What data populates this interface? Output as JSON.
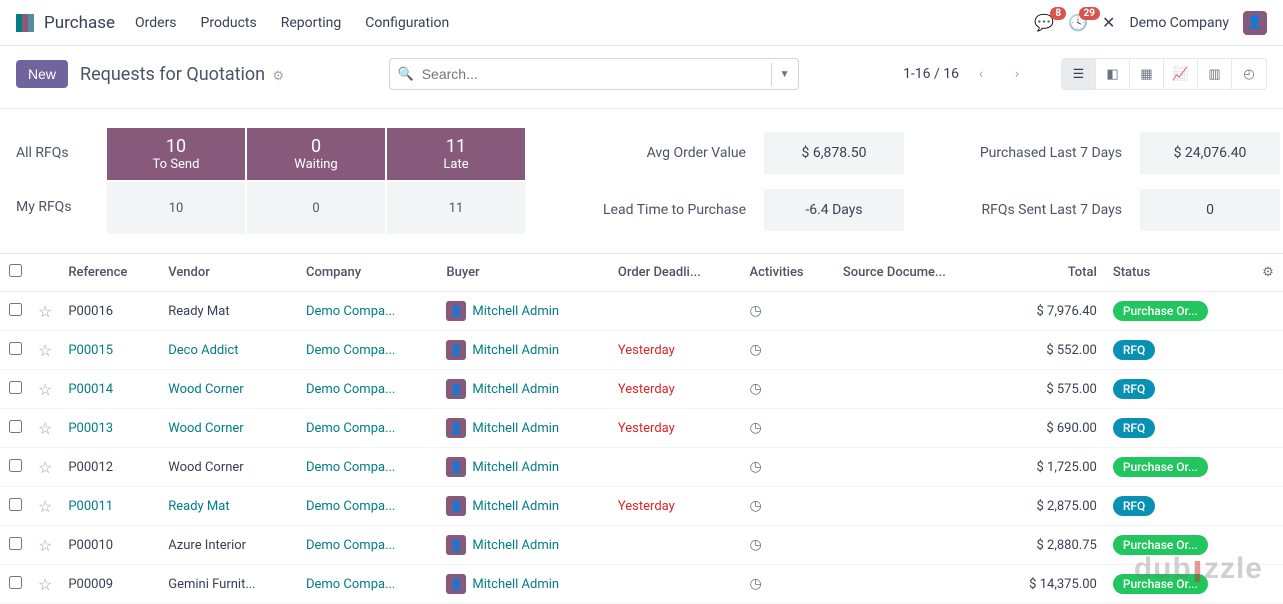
{
  "nav": {
    "app_name": "Purchase",
    "links": [
      "Orders",
      "Products",
      "Reporting",
      "Configuration"
    ],
    "msg_badge": "8",
    "activity_badge": "29",
    "company": "Demo Company"
  },
  "cp": {
    "new_btn": "New",
    "title": "Requests for Quotation",
    "search_placeholder": "Search...",
    "pager": "1-16 / 16"
  },
  "dash": {
    "row_labels": [
      "All RFQs",
      "My RFQs"
    ],
    "cols": [
      {
        "top_num": "10",
        "top_cap": "To Send",
        "bot": "10"
      },
      {
        "top_num": "0",
        "top_cap": "Waiting",
        "bot": "0"
      },
      {
        "top_num": "11",
        "top_cap": "Late",
        "bot": "11"
      }
    ],
    "metrics": [
      {
        "label": "Avg Order Value",
        "value": "$ 6,878.50"
      },
      {
        "label": "Purchased Last 7 Days",
        "value": "$ 24,076.40"
      },
      {
        "label": "Lead Time to Purchase",
        "value": "-6.4 Days"
      },
      {
        "label": "RFQs Sent Last 7 Days",
        "value": "0"
      }
    ]
  },
  "table": {
    "headers": [
      "Reference",
      "Vendor",
      "Company",
      "Buyer",
      "Order Deadli...",
      "Activities",
      "Source Docume...",
      "Total",
      "Status"
    ],
    "rows": [
      {
        "ref": "P00016",
        "ref_link": false,
        "vendor": "Ready Mat",
        "vendor_link": false,
        "company": "Demo Compa...",
        "buyer": "Mitchell Admin",
        "deadline": "",
        "deadline_red": false,
        "total": "$ 7,976.40",
        "status": "Purchase Or...",
        "status_kind": "green"
      },
      {
        "ref": "P00015",
        "ref_link": true,
        "vendor": "Deco Addict",
        "vendor_link": true,
        "company": "Demo Compa...",
        "buyer": "Mitchell Admin",
        "deadline": "Yesterday",
        "deadline_red": true,
        "total": "$ 552.00",
        "status": "RFQ",
        "status_kind": "teal"
      },
      {
        "ref": "P00014",
        "ref_link": true,
        "vendor": "Wood Corner",
        "vendor_link": true,
        "company": "Demo Compa...",
        "buyer": "Mitchell Admin",
        "deadline": "Yesterday",
        "deadline_red": true,
        "total": "$ 575.00",
        "status": "RFQ",
        "status_kind": "teal"
      },
      {
        "ref": "P00013",
        "ref_link": true,
        "vendor": "Wood Corner",
        "vendor_link": true,
        "company": "Demo Compa...",
        "buyer": "Mitchell Admin",
        "deadline": "Yesterday",
        "deadline_red": true,
        "total": "$ 690.00",
        "status": "RFQ",
        "status_kind": "teal"
      },
      {
        "ref": "P00012",
        "ref_link": false,
        "vendor": "Wood Corner",
        "vendor_link": false,
        "company": "Demo Compa...",
        "buyer": "Mitchell Admin",
        "deadline": "",
        "deadline_red": false,
        "total": "$ 1,725.00",
        "status": "Purchase Or...",
        "status_kind": "green"
      },
      {
        "ref": "P00011",
        "ref_link": true,
        "vendor": "Ready Mat",
        "vendor_link": true,
        "company": "Demo Compa...",
        "buyer": "Mitchell Admin",
        "deadline": "Yesterday",
        "deadline_red": true,
        "total": "$ 2,875.00",
        "status": "RFQ",
        "status_kind": "teal"
      },
      {
        "ref": "P00010",
        "ref_link": false,
        "vendor": "Azure Interior",
        "vendor_link": false,
        "company": "Demo Compa...",
        "buyer": "Mitchell Admin",
        "deadline": "",
        "deadline_red": false,
        "total": "$ 2,880.75",
        "status": "Purchase Or...",
        "status_kind": "green"
      },
      {
        "ref": "P00009",
        "ref_link": false,
        "vendor": "Gemini Furnit...",
        "vendor_link": false,
        "company": "Demo Compa...",
        "buyer": "Mitchell Admin",
        "deadline": "",
        "deadline_red": false,
        "total": "$ 14,375.00",
        "status": "Purchase Or...",
        "status_kind": "green"
      }
    ]
  },
  "watermark": "dub zzle"
}
